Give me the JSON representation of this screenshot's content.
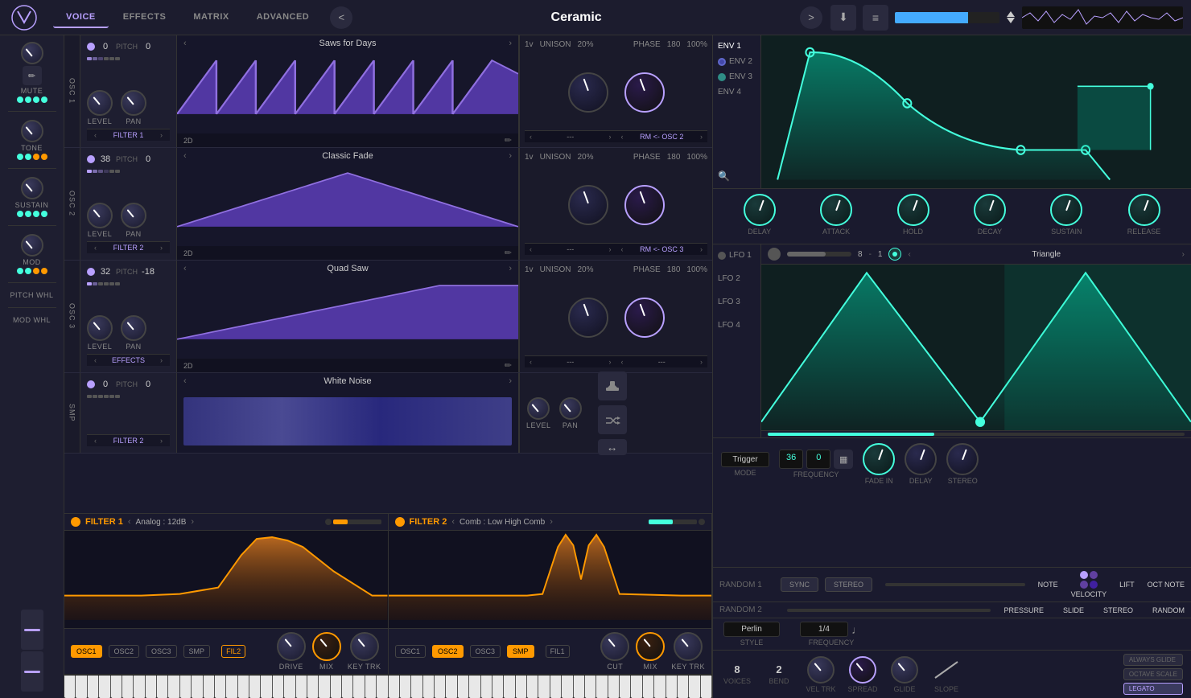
{
  "app": {
    "logo": "V",
    "nav_tabs": [
      "VOICE",
      "EFFECTS",
      "MATRIX",
      "ADVANCED"
    ],
    "active_tab": "VOICE",
    "preset_name": "Ceramic",
    "nav_prev": "<",
    "nav_next": ">"
  },
  "left_panel": {
    "mute_label": "MUTE",
    "tone_label": "TONE",
    "sustain_label": "SUSTAIN",
    "mod_label": "MOD",
    "pitch_whl_label": "PITCH WHL",
    "mod_whl_label": "MOD WHL"
  },
  "osc_rows": [
    {
      "id": "OSC 1",
      "pitch_left": "0",
      "pitch_right": "0",
      "wave_name": "Saws for Days",
      "unison_voices": "1v",
      "unison_pct": "20%",
      "phase_val": "180",
      "phase_pct": "100%",
      "filter": "FILTER 1",
      "mode": "2D",
      "mod_src": "---",
      "rm_label": "RM <- OSC 2"
    },
    {
      "id": "OSC 2",
      "pitch_left": "38",
      "pitch_right": "0",
      "wave_name": "Classic Fade",
      "unison_voices": "1v",
      "unison_pct": "20%",
      "phase_val": "180",
      "phase_pct": "100%",
      "filter": "FILTER 2",
      "mode": "2D",
      "mod_src": "---",
      "rm_label": "RM <- OSC 3"
    },
    {
      "id": "OSC 3",
      "pitch_left": "32",
      "pitch_right": "-18",
      "wave_name": "Quad Saw",
      "unison_voices": "1v",
      "unison_pct": "20%",
      "phase_val": "180",
      "phase_pct": "100%",
      "filter": "EFFECTS",
      "mode": "2D",
      "mod_src": "---",
      "rm_label": "---"
    }
  ],
  "smp": {
    "id": "SMP",
    "pitch_left": "0",
    "pitch_right": "0",
    "wave_name": "White Noise",
    "filter": "FILTER 2"
  },
  "filter1": {
    "title": "FILTER 1",
    "type": "Analog : 12dB",
    "osc_chips": [
      "OSC1",
      "OSC2",
      "OSC3",
      "SMP"
    ],
    "active_chip": "OSC1",
    "second_label": "FIL2",
    "drive_label": "DRIVE",
    "mix_label": "MIX",
    "key_trk_label": "KEY TRK"
  },
  "filter2": {
    "title": "FILTER 2",
    "type": "Comb : Low High Comb",
    "osc_chips": [
      "OSC1",
      "OSC2",
      "OSC3",
      "SMP"
    ],
    "active_chip": "OSC2",
    "second_label": "FIL1",
    "cut_label": "CUT",
    "mix_label": "MIX",
    "key_trk_label": "KEY TRK"
  },
  "env": {
    "labels": [
      "ENV 1",
      "ENV 2",
      "ENV 3",
      "ENV 4"
    ],
    "active": "ENV 1",
    "knobs": [
      "DELAY",
      "ATTACK",
      "HOLD",
      "DECAY",
      "SUSTAIN",
      "RELEASE"
    ]
  },
  "lfo": {
    "labels": [
      "LFO 1",
      "LFO 2",
      "LFO 3",
      "LFO 4"
    ],
    "active": "LFO 1",
    "rate_a": "8",
    "rate_b": "1",
    "wave_type": "Triangle",
    "mode_label": "MODE",
    "freq_label": "FREQUENCY",
    "fade_in_label": "FADE IN",
    "delay_label": "DELAY",
    "stereo_label": "STEREO",
    "mode_val": "Trigger",
    "freq_a": "36",
    "freq_b": "0"
  },
  "random": {
    "r1_label": "RANDOM 1",
    "r2_label": "RANDOM 2",
    "sync_btn": "SYNC",
    "stereo_btn": "STEREO",
    "note_label": "NOTE",
    "velocity_label": "VELOCITY",
    "lift_label": "LIFT",
    "oct_note_label": "OCT NOTE",
    "pressure_label": "PRESSURE",
    "slide_label": "SLIDE",
    "stereo_label2": "STEREO",
    "random_label": "RANDOM",
    "perlin_label": "Perlin",
    "freq_val": "1/4",
    "style_label": "STYLE",
    "frequency_label": "FREQUENCY"
  },
  "voice_row": {
    "voices_val": "8",
    "voices_label": "VOICES",
    "bend_val": "2",
    "bend_label": "BEND",
    "vel_trk_label": "VEL TRK",
    "spread_label": "SPREAD",
    "glide_label": "GLIDE",
    "slope_label": "SLOPE",
    "always_glide": "ALWAYS GLIDE",
    "octave_scale": "OCTAVE SCALE",
    "legato": "LEGATO"
  }
}
